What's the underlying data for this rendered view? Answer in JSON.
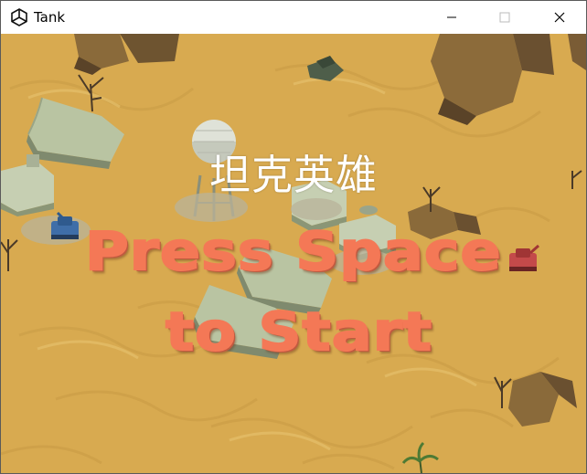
{
  "window": {
    "title": "Tank",
    "controls": {
      "minimize": "minimize-icon",
      "maximize": "maximize-icon",
      "close": "close-icon"
    }
  },
  "game": {
    "title": "坦克英雄",
    "prompt_line1": "Press Space",
    "prompt_line2": "to Start"
  },
  "colors": {
    "sand": "#d8aa50",
    "prompt": "#f47856",
    "title_text": "#ffffff"
  }
}
